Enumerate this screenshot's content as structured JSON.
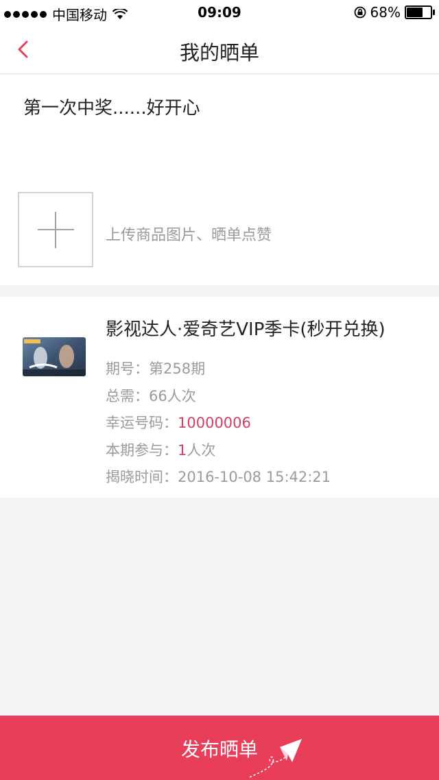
{
  "status_bar": {
    "carrier": "中国移动",
    "time": "09:09",
    "battery": "68%",
    "battery_level": 0.68
  },
  "nav": {
    "title": "我的晒单",
    "back_icon": "chevron-left-icon"
  },
  "post": {
    "text": "第一次中奖......好开心",
    "upload_hint": "上传商品图片、晒单点赞",
    "upload_icon": "plus-icon"
  },
  "product": {
    "name": "影视达人·爱奇艺VIP季卡(秒开兑换)",
    "issue_label": "期号：",
    "issue_value": "第258期",
    "total_label": "总需：",
    "total_value": "66人次",
    "lucky_label": "幸运号码：",
    "lucky_value": "10000006",
    "join_label": "本期参与：",
    "join_count": "1",
    "join_unit": "人次",
    "reveal_label": "揭晓时间：",
    "reveal_value": "2016-10-08 15:42:21"
  },
  "publish": {
    "label": "发布晒单",
    "icon": "paper-plane-icon"
  },
  "colors": {
    "accent": "#e83e5a",
    "highlight": "#d1405e",
    "muted": "#9a9a9a"
  }
}
